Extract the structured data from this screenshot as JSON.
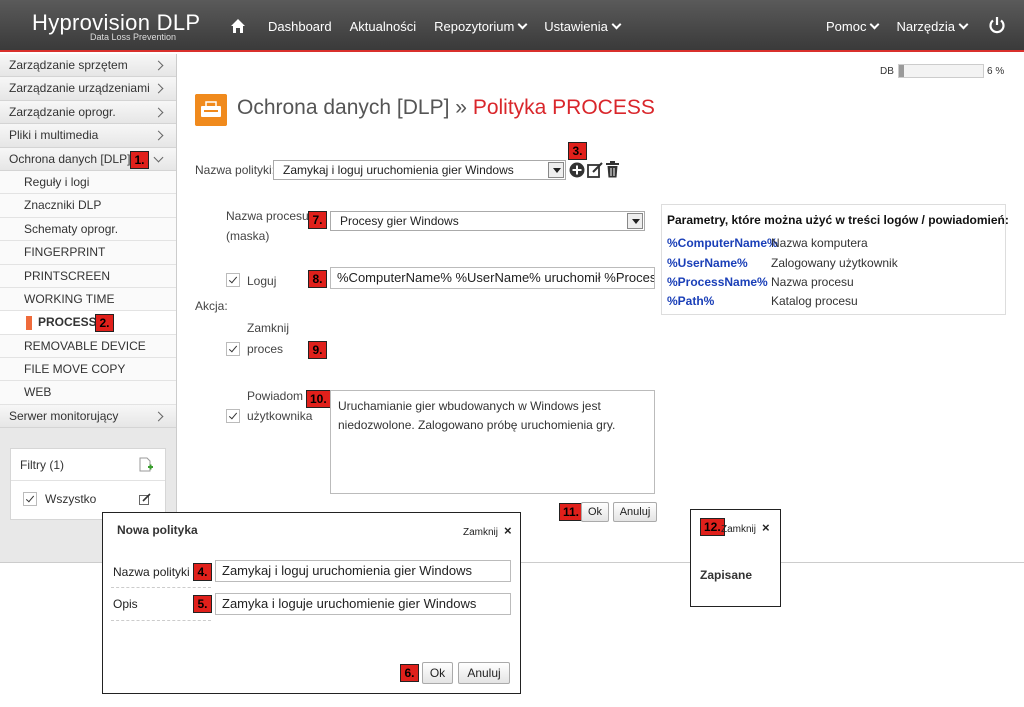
{
  "app": {
    "brand": "Hyprovision DLP",
    "brand_sub": "Data Loss Prevention"
  },
  "nav": {
    "items": [
      "Dashboard",
      "Aktualności",
      "Repozytorium",
      "Ustawienia"
    ],
    "right": [
      "Pomoc",
      "Narzędzia"
    ],
    "icons": {
      "home": "home-icon",
      "power": "power-icon"
    }
  },
  "sidebar": {
    "items": [
      "Zarządzanie sprzętem",
      "Zarządzanie urządzeniami",
      "Zarządzanie oprogr.",
      "Pliki i multimedia",
      "Ochrona danych [DLP]"
    ],
    "subitems": [
      "Reguły i logi",
      "Znaczniki DLP",
      "Schematy oprogr.",
      "FINGERPRINT",
      "PRINTSCREEN",
      "WORKING TIME",
      "PROCESS",
      "REMOVABLE DEVICE",
      "FILE MOVE COPY",
      "WEB"
    ],
    "last_item": "Serwer monitorujący",
    "filters": {
      "title": "Filtry (1)",
      "row": "Wszystko"
    }
  },
  "db": {
    "label": "DB",
    "percent_text": "6 %",
    "fill": 0.06
  },
  "page": {
    "title_prefix": "Ochrona danych [DLP] » ",
    "title_accent": "Polityka PROCESS"
  },
  "form": {
    "policy_name_label": "Nazwa polityki:",
    "policy_name_value": "Zamykaj i loguj uruchomienia gier Windows",
    "process_name_label": "Nazwa procesu",
    "process_mask_label": "(maska)",
    "process_value": "Procesy gier Windows",
    "log_label": "Loguj",
    "log_value": "%ComputerName% %UserName% uruchomił %ProcessName%",
    "action_label": "Akcja:",
    "close_process_label_1": "Zamknij",
    "close_process_label_2": "proces",
    "notify_label_1": "Powiadom",
    "notify_label_2": "użytkownika",
    "notify_text": "Uruchamianie gier wbudowanych w Windows jest niedozwolone. Zalogowano próbę uruchomienia gry.",
    "ok": "Ok",
    "cancel": "Anuluj"
  },
  "params": {
    "heading": "Parametry, które można użyć w treści logów / powiadomień:",
    "rows": [
      {
        "key": "%ComputerName%",
        "desc": "Nazwa komputera"
      },
      {
        "key": "%UserName%",
        "desc": "Zalogowany użytkownik"
      },
      {
        "key": "%ProcessName%",
        "desc": "Nazwa procesu"
      },
      {
        "key": "%Path%",
        "desc": "Katalog procesu"
      }
    ]
  },
  "dialog_new": {
    "title": "Nowa polityka",
    "close": "Zamknij",
    "name_label": "Nazwa polityki",
    "name_value": "Zamykaj i loguj uruchomienia gier Windows",
    "desc_label": "Opis",
    "desc_value": "Zamyka i loguje uruchomienie gier Windows",
    "ok": "Ok",
    "cancel": "Anuluj"
  },
  "dialog_saved": {
    "close": "Zamknij",
    "message": "Zapisane"
  },
  "badges": [
    "1.",
    "2.",
    "3.",
    "4.",
    "5.",
    "6.",
    "7.",
    "8.",
    "9.",
    "10.",
    "11.",
    "12."
  ],
  "colors": {
    "accent": "#d9262b",
    "badge": "#e0201b",
    "icon_orange": "#f08a1d",
    "param_key": "#1a3fb8"
  }
}
